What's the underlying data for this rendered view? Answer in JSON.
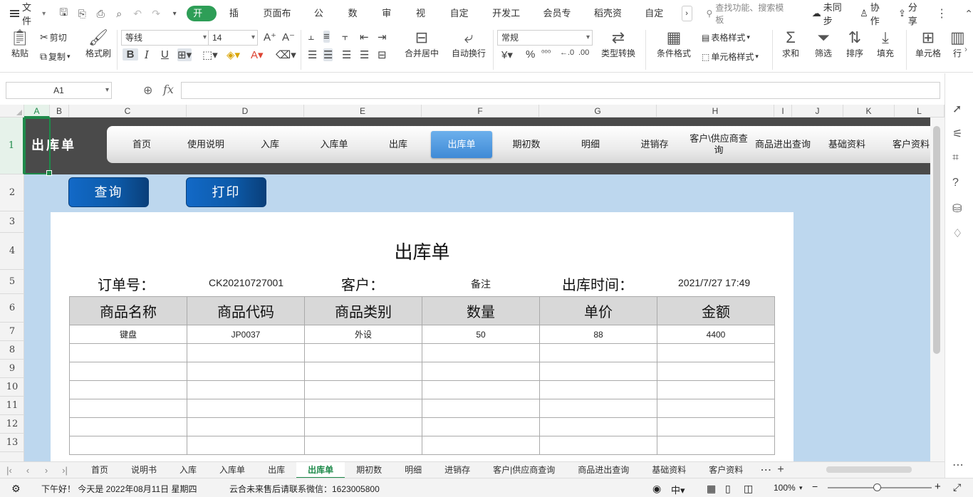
{
  "menubar": {
    "file_label": "文件",
    "tabs": [
      "开始",
      "插入",
      "页面布局",
      "公式",
      "数据",
      "审阅",
      "视图",
      "自定义",
      "开发工具",
      "会员专享",
      "稻壳资源",
      "自定义"
    ],
    "search_placeholder": "查找功能、搜索模板",
    "sync_label": "未同步",
    "collab_label": "协作",
    "share_label": "分享"
  },
  "ribbon": {
    "paste": "粘贴",
    "cut": "剪切",
    "copy": "复制",
    "format_painter": "格式刷",
    "font_name": "等线",
    "font_size": "14",
    "merge_center": "合并居中",
    "wrap_text": "自动换行",
    "number_format": "常规",
    "type_convert": "类型转换",
    "cond_format": "条件格式",
    "table_style": "表格样式",
    "cell_style": "单元格样式",
    "sum": "求和",
    "filter": "筛选",
    "sort": "排序",
    "fill": "填充",
    "cell": "单元格",
    "row_col": "行"
  },
  "formula": {
    "name_box": "A1",
    "fx": "fx",
    "value": ""
  },
  "columns": [
    "A",
    "B",
    "C",
    "D",
    "E",
    "F",
    "G",
    "H",
    "I",
    "J",
    "K",
    "L"
  ],
  "rows": [
    "1",
    "2",
    "3",
    "4",
    "5",
    "6",
    "7",
    "8",
    "9",
    "10",
    "11",
    "12",
    "13"
  ],
  "nav": {
    "title": "出库单",
    "items": [
      "首页",
      "使用说明",
      "入库",
      "入库单",
      "出库",
      "出库单",
      "期初数",
      "明细",
      "进销存",
      "客户\\供应商查询",
      "商品进出查询",
      "基础资料",
      "客户资料"
    ],
    "active_index": 5
  },
  "buttons": {
    "query": "查询",
    "print": "打印"
  },
  "document": {
    "title": "出库单",
    "order_label": "订单号：",
    "order_value": "CK20210727001",
    "customer_label": "客户：",
    "note_value": "备注",
    "time_label": "出库时间：",
    "time_value": "2021/7/27 17:49",
    "table_headers": [
      "商品名称",
      "商品代码",
      "商品类别",
      "数量",
      "单价",
      "金额"
    ],
    "table_rows": [
      [
        "键盘",
        "JP0037",
        "外设",
        "50",
        "88",
        "4400"
      ],
      [
        "",
        "",
        "",
        "",
        "",
        ""
      ],
      [
        "",
        "",
        "",
        "",
        "",
        ""
      ],
      [
        "",
        "",
        "",
        "",
        "",
        ""
      ],
      [
        "",
        "",
        "",
        "",
        "",
        ""
      ],
      [
        "",
        "",
        "",
        "",
        "",
        ""
      ],
      [
        "",
        "",
        "",
        "",
        "",
        ""
      ]
    ]
  },
  "sheet_tabs": [
    "首页",
    "说明书",
    "入库",
    "入库单",
    "出库",
    "出库单",
    "期初数",
    "明细",
    "进销存",
    "客户|供应商查询",
    "商品进出查询",
    "基础资料",
    "客户资料"
  ],
  "active_sheet": "出库单",
  "status": {
    "greeting": "下午好！ 今天是 2022年08月11日 星期四",
    "message": "云合未来售后请联系微信：1623005800",
    "zoom": "100%"
  }
}
